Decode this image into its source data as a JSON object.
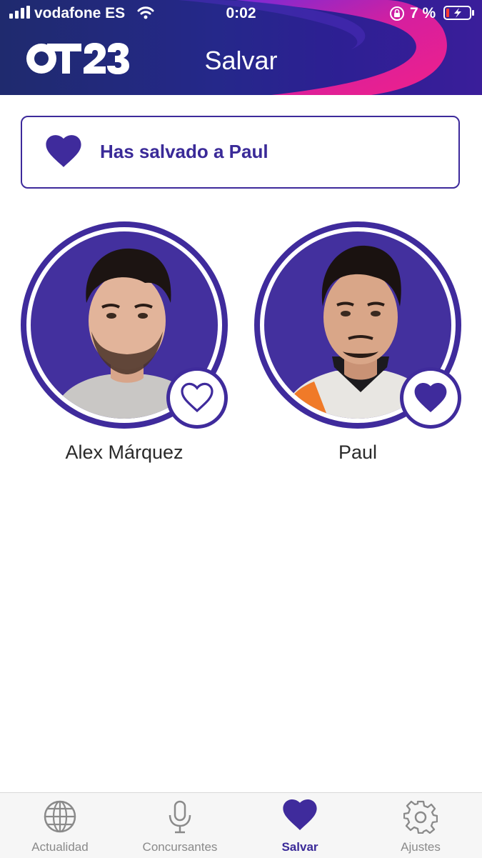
{
  "status_bar": {
    "carrier": "vodafone ES",
    "time": "0:02",
    "battery": "7 %"
  },
  "header": {
    "logo_text": "OT23",
    "title": "Salvar"
  },
  "notice": {
    "text": "Has salvado a Paul"
  },
  "contestants": [
    {
      "name": "Alex Márquez",
      "saved": false
    },
    {
      "name": "Paul",
      "saved": true
    }
  ],
  "tabbar": {
    "tabs": [
      {
        "label": "Actualidad",
        "icon": "globe-icon"
      },
      {
        "label": "Concursantes",
        "icon": "microphone-icon"
      },
      {
        "label": "Salvar",
        "icon": "heart-icon",
        "active": true
      },
      {
        "label": "Ajustes",
        "icon": "gear-icon"
      }
    ]
  },
  "colors": {
    "brand_purple": "#3f2b9c",
    "header_blue": "#25288a",
    "accent_pink": "#e0208c",
    "inactive_gray": "#8a8a8a"
  }
}
